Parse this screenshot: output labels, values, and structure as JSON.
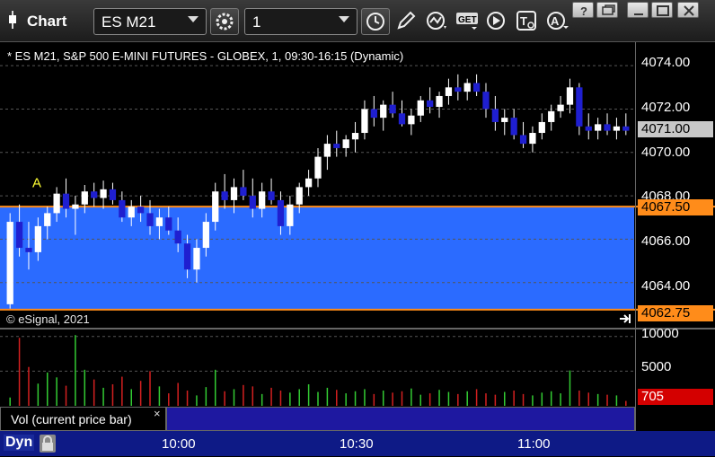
{
  "window": {
    "title": "Chart",
    "symbol": "ES M21",
    "interval": "1",
    "buttons": [
      "settings-icon",
      "clock-icon",
      "pencil-icon",
      "study-icon",
      "get-icon",
      "play-icon",
      "text-tool-icon",
      "alert-icon"
    ]
  },
  "chart": {
    "header": "* ES M21, S&P 500 E-MINI FUTURES - GLOBEX, 1, 09:30-16:15 (Dynamic)",
    "copyright": "© eSignal, 2021",
    "marker": "A",
    "price_axis": [
      "4074.00",
      "4072.00",
      "4070.00",
      "4068.00",
      "4066.00",
      "4064.00"
    ],
    "price_tags": {
      "last": "4071.00",
      "upper_line": "4067.50",
      "lower_line": "4062.75"
    },
    "volume_axis": [
      "10000",
      "5000"
    ],
    "volume_tag": "705",
    "volume_study_label": "Vol (current price bar)",
    "volume_close": "×",
    "time_axis": [
      "10:00",
      "10:30",
      "11:00"
    ],
    "bottom_label": "Dyn",
    "colors": {
      "up_candle": "#ffffff",
      "down_candle": "#1f1fd0",
      "band": "#2b6bff",
      "band_line": "#ff8c1a",
      "last_tag": "#c8c8c8",
      "volume_tag": "#d40000"
    }
  },
  "chart_data": {
    "type": "candlestick",
    "ylim": [
      4062.0,
      4075.0
    ],
    "band": [
      4062.75,
      4067.5
    ],
    "last": 4071.0,
    "candles": [
      [
        4063.0,
        4067.2,
        4062.8,
        4066.8
      ],
      [
        4066.8,
        4067.6,
        4065.2,
        4065.6
      ],
      [
        4065.6,
        4066.8,
        4064.6,
        4065.4
      ],
      [
        4065.4,
        4067.0,
        4065.0,
        4066.6
      ],
      [
        4066.6,
        4067.5,
        4066.0,
        4067.2
      ],
      [
        4067.2,
        4068.4,
        4066.8,
        4068.1
      ],
      [
        4068.1,
        4068.8,
        4067.0,
        4067.4
      ],
      [
        4067.4,
        4068.0,
        4066.2,
        4067.6
      ],
      [
        4067.6,
        4068.5,
        4067.2,
        4068.2
      ],
      [
        4068.2,
        4068.6,
        4067.5,
        4067.9
      ],
      [
        4067.9,
        4068.7,
        4067.4,
        4068.3
      ],
      [
        4068.3,
        4068.6,
        4067.6,
        4067.8
      ],
      [
        4067.8,
        4068.2,
        4066.8,
        4067.0
      ],
      [
        4067.0,
        4067.8,
        4066.6,
        4067.5
      ],
      [
        4067.5,
        4068.0,
        4066.8,
        4067.2
      ],
      [
        4067.2,
        4067.8,
        4066.2,
        4066.6
      ],
      [
        4066.6,
        4067.4,
        4066.0,
        4067.0
      ],
      [
        4067.0,
        4067.5,
        4066.2,
        4066.4
      ],
      [
        4066.4,
        4067.0,
        4065.4,
        4065.8
      ],
      [
        4065.8,
        4066.2,
        4064.2,
        4064.6
      ],
      [
        4064.6,
        4066.0,
        4064.0,
        4065.6
      ],
      [
        4065.6,
        4067.2,
        4065.2,
        4066.8
      ],
      [
        4066.8,
        4068.6,
        4066.4,
        4068.2
      ],
      [
        4068.2,
        4069.0,
        4067.4,
        4067.8
      ],
      [
        4067.8,
        4068.8,
        4067.2,
        4068.4
      ],
      [
        4068.4,
        4069.2,
        4067.8,
        4068.0
      ],
      [
        4068.0,
        4068.8,
        4067.0,
        4067.4
      ],
      [
        4067.4,
        4068.6,
        4067.0,
        4068.2
      ],
      [
        4068.2,
        4068.8,
        4067.6,
        4067.8
      ],
      [
        4067.8,
        4068.2,
        4066.2,
        4066.6
      ],
      [
        4066.6,
        4068.0,
        4066.2,
        4067.6
      ],
      [
        4067.6,
        4068.6,
        4067.2,
        4068.4
      ],
      [
        4068.4,
        4069.2,
        4068.0,
        4068.8
      ],
      [
        4068.8,
        4070.2,
        4068.4,
        4069.8
      ],
      [
        4069.8,
        4070.8,
        4069.2,
        4070.4
      ],
      [
        4070.4,
        4071.0,
        4069.8,
        4070.2
      ],
      [
        4070.2,
        4070.8,
        4069.8,
        4070.6
      ],
      [
        4070.6,
        4071.4,
        4070.0,
        4070.9
      ],
      [
        4070.9,
        4072.4,
        4070.6,
        4072.0
      ],
      [
        4072.0,
        4072.6,
        4071.2,
        4071.6
      ],
      [
        4071.6,
        4072.4,
        4071.0,
        4072.2
      ],
      [
        4072.2,
        4072.8,
        4071.6,
        4071.8
      ],
      [
        4071.8,
        4072.4,
        4071.2,
        4071.3
      ],
      [
        4071.3,
        4072.0,
        4070.8,
        4071.7
      ],
      [
        4071.7,
        4072.6,
        4071.4,
        4072.4
      ],
      [
        4072.4,
        4073.0,
        4071.8,
        4072.1
      ],
      [
        4072.1,
        4072.8,
        4071.6,
        4072.6
      ],
      [
        4072.6,
        4073.4,
        4072.2,
        4073.0
      ],
      [
        4073.0,
        4073.6,
        4072.4,
        4072.8
      ],
      [
        4072.8,
        4073.4,
        4072.4,
        4073.2
      ],
      [
        4073.2,
        4073.6,
        4072.6,
        4072.8
      ],
      [
        4072.8,
        4073.2,
        4071.6,
        4072.0
      ],
      [
        4072.0,
        4072.6,
        4071.0,
        4071.4
      ],
      [
        4071.4,
        4072.0,
        4070.8,
        4071.6
      ],
      [
        4071.6,
        4072.0,
        4070.6,
        4070.8
      ],
      [
        4070.8,
        4071.4,
        4070.2,
        4070.4
      ],
      [
        4070.4,
        4071.2,
        4070.0,
        4070.9
      ],
      [
        4070.9,
        4071.8,
        4070.6,
        4071.4
      ],
      [
        4071.4,
        4072.2,
        4071.0,
        4071.9
      ],
      [
        4071.9,
        4072.6,
        4071.6,
        4072.2
      ],
      [
        4072.2,
        4073.4,
        4071.8,
        4073.0
      ],
      [
        4073.0,
        4073.2,
        4070.8,
        4071.2
      ],
      [
        4071.2,
        4071.8,
        4070.6,
        4071.0
      ],
      [
        4071.0,
        4071.6,
        4070.6,
        4071.3
      ],
      [
        4071.3,
        4071.8,
        4070.8,
        4071.0
      ],
      [
        4071.0,
        4071.6,
        4070.6,
        4071.2
      ],
      [
        4071.2,
        4071.8,
        4070.8,
        4071.0
      ]
    ],
    "volume": [
      1200,
      9800,
      5600,
      3200,
      4800,
      4100,
      2900,
      10200,
      5200,
      3800,
      2600,
      3100,
      4200,
      2400,
      3600,
      5000,
      2800,
      1800,
      3300,
      2200,
      1500,
      2700,
      5200,
      2100,
      2400,
      3000,
      2800,
      1700,
      2600,
      2200,
      1900,
      2400,
      3100,
      2000,
      2600,
      2300,
      1800,
      2100,
      2400,
      1700,
      2200,
      1900,
      2100,
      2500,
      1600,
      1800,
      2300,
      2000,
      1700,
      2100,
      2400,
      1800,
      1600,
      2000,
      2200,
      1700,
      1500,
      1900,
      2100,
      1800,
      5100,
      2200,
      1900,
      1700,
      1600,
      1500,
      705
    ]
  }
}
